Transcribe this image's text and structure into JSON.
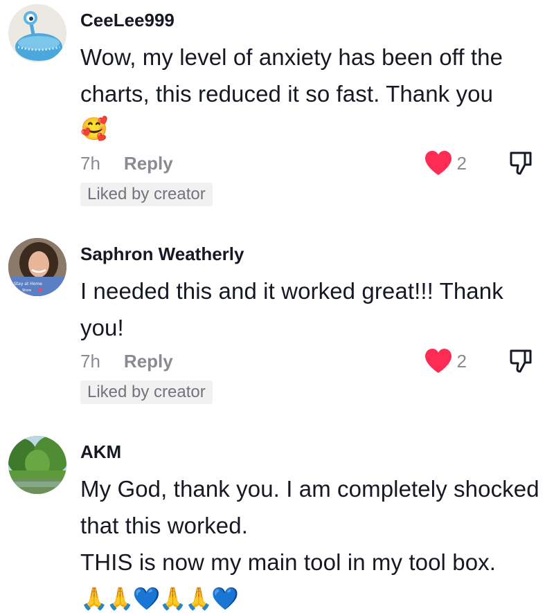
{
  "comments": [
    {
      "username": "CeeLee999",
      "text": "Wow, my level of anxiety has been off the charts, this reduced it so fast. Thank you",
      "emoji": "🥰",
      "time": "7h",
      "reply_label": "Reply",
      "likes": "2",
      "badge": "Liked by creator",
      "avatar": "blue-alien-avatar"
    },
    {
      "username": "Saphron Weatherly",
      "text": "I needed this and it worked great!!! Thank you!",
      "time": "7h",
      "reply_label": "Reply",
      "likes": "2",
      "badge": "Liked by creator",
      "avatar": "woman-photo-avatar"
    },
    {
      "username": "AKM",
      "text_line1": "My God, thank you. I am completely shocked that this worked.",
      "text_line2": "THIS is now my main tool in my tool box.",
      "emoji": "🙏🙏💙🙏🙏💙",
      "avatar": "landscape-photo-avatar"
    }
  ],
  "colors": {
    "heart": "#fe2c55",
    "muted": "#8a8b91",
    "badge_bg": "#f1f1f2"
  }
}
